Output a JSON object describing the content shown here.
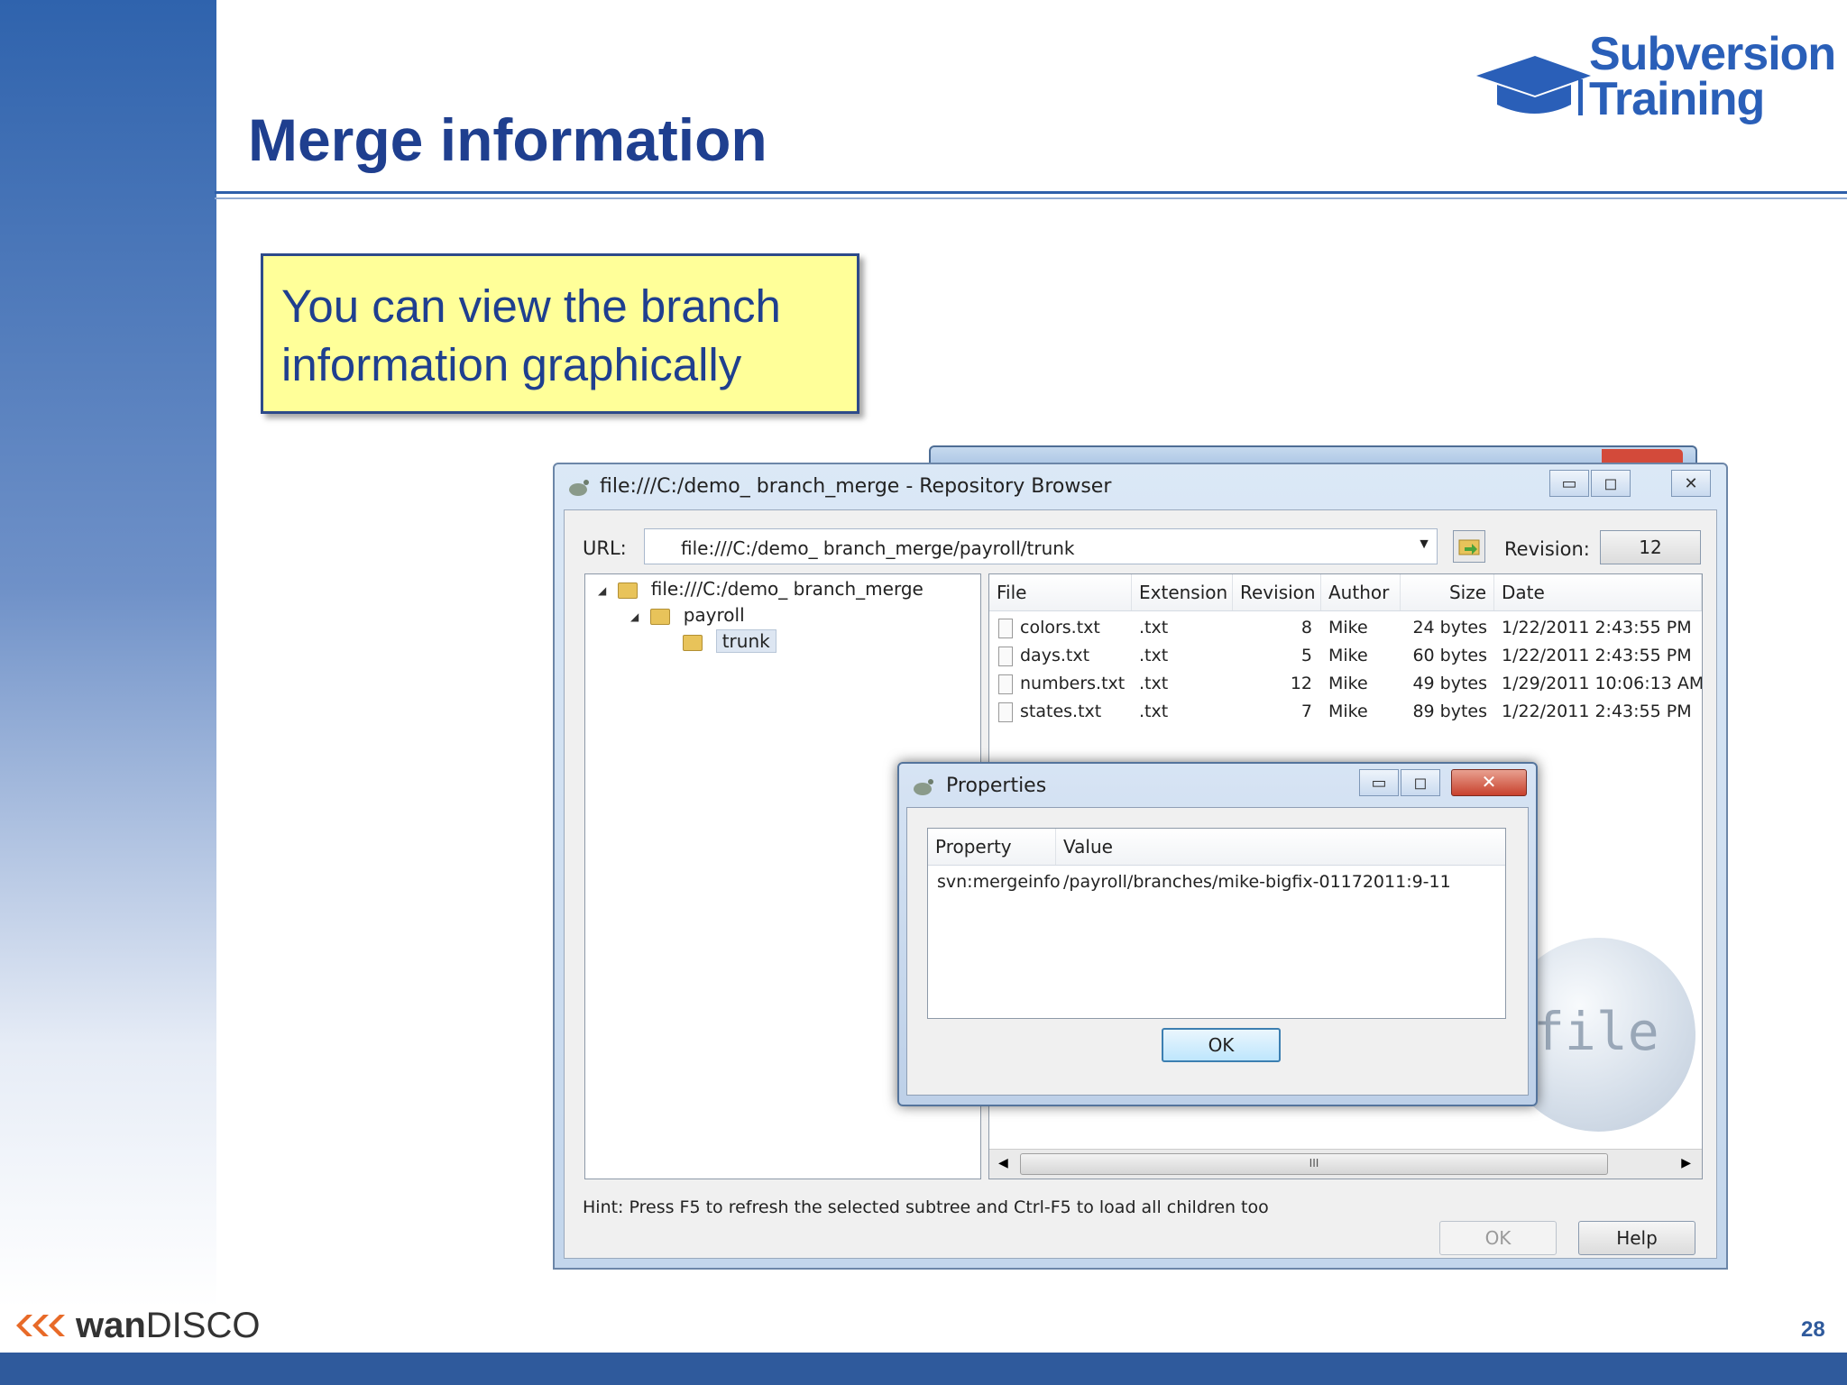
{
  "slide": {
    "title": "Merge information",
    "callout_line1": "You can view the branch",
    "callout_line2": "information graphically",
    "page_number": "28"
  },
  "logo": {
    "word1": "Subversion",
    "word2": "Training"
  },
  "footer": {
    "brand_bold": "wan",
    "brand_light": "DISCO"
  },
  "repo_browser": {
    "title": "file:///C:/demo_ branch_merge - Repository Browser",
    "url_label": "URL:",
    "url_value": "file:///C:/demo_ branch_merge/payroll/trunk",
    "revision_label": "Revision:",
    "revision_value": "12",
    "tree": [
      {
        "label": "file:///C:/demo_ branch_merge",
        "expander": "◢"
      },
      {
        "label": "payroll",
        "expander": "◢"
      },
      {
        "label": "trunk",
        "expander": ""
      }
    ],
    "columns": [
      "File",
      "Extension",
      "Revision",
      "Author",
      "Size",
      "Date"
    ],
    "files": [
      {
        "file": "colors.txt",
        "ext": ".txt",
        "rev": "8",
        "author": "Mike",
        "size": "24 bytes",
        "date": "1/22/2011 2:43:55 PM"
      },
      {
        "file": "days.txt",
        "ext": ".txt",
        "rev": "5",
        "author": "Mike",
        "size": "60 bytes",
        "date": "1/22/2011 2:43:55 PM"
      },
      {
        "file": "numbers.txt",
        "ext": ".txt",
        "rev": "12",
        "author": "Mike",
        "size": "49 bytes",
        "date": "1/29/2011 10:06:13 AM"
      },
      {
        "file": "states.txt",
        "ext": ".txt",
        "rev": "7",
        "author": "Mike",
        "size": "89 bytes",
        "date": "1/22/2011 2:43:55 PM"
      }
    ],
    "scroll_grip": "III",
    "hint": "Hint: Press F5 to refresh the selected subtree and Ctrl-F5 to load all children too",
    "ok_label": "OK",
    "help_label": "Help",
    "watermark_text": "file"
  },
  "properties": {
    "title": "Properties",
    "col_property": "Property",
    "col_value": "Value",
    "property": "svn:mergeinfo",
    "value": "/payroll/branches/mike-bigfix-01172011:9-11",
    "ok_label": "OK"
  },
  "colors": {
    "accent": "#1f3f8f",
    "callout_bg": "#ffff99",
    "footer": "#2f5a9c"
  }
}
